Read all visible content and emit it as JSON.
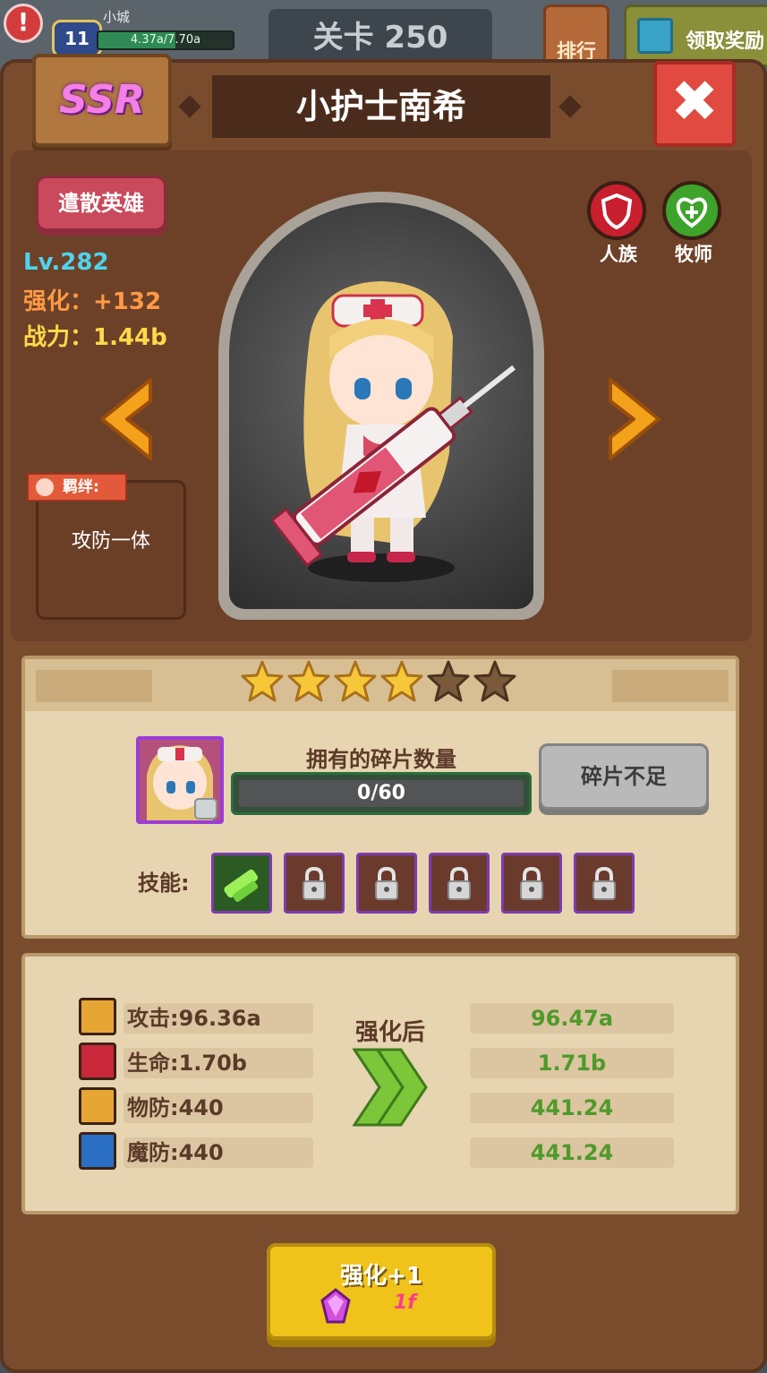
{
  "hud": {
    "alert": "!",
    "level": "11",
    "town": "小城",
    "exp_text": "4.37a/7.70a",
    "exp_progress": 0.57,
    "stage": "关卡 250",
    "rank": "排行",
    "reward": "领取奖励"
  },
  "hero": {
    "rarity": "SSR",
    "name": "小护士南希",
    "dismiss": "遣散英雄",
    "level": "Lv.282",
    "enhance": "强化：+132",
    "power": "战力：1.44b",
    "bond_tag": "羁绊:",
    "bond_name": "攻防一体",
    "race": "人族",
    "class": "牧师",
    "close": "✖"
  },
  "stars": {
    "total": 6,
    "filled": 4
  },
  "fragments": {
    "title": "拥有的碎片数量",
    "count": "0/60",
    "progress": 0.0,
    "button": "碎片不足"
  },
  "skills": {
    "label": "技能:",
    "items": [
      {
        "locked": false
      },
      {
        "locked": true
      },
      {
        "locked": true
      },
      {
        "locked": true
      },
      {
        "locked": true
      },
      {
        "locked": true
      }
    ]
  },
  "stats": {
    "after_label": "强化后",
    "rows": [
      {
        "label": "攻击:96.36a",
        "after": "96.47a",
        "icon": "sword-icon",
        "color": "#e7a634"
      },
      {
        "label": "生命:1.70b",
        "after": "1.71b",
        "icon": "heart-icon",
        "color": "#c9283a"
      },
      {
        "label": "物防:440",
        "after": "441.24",
        "icon": "shield-icon",
        "color": "#e7a634"
      },
      {
        "label": "魔防:440",
        "after": "441.24",
        "icon": "magic-shield-icon",
        "color": "#2a6fc4"
      }
    ]
  },
  "upgrade": {
    "label": "强化+1",
    "cost": "1f"
  }
}
